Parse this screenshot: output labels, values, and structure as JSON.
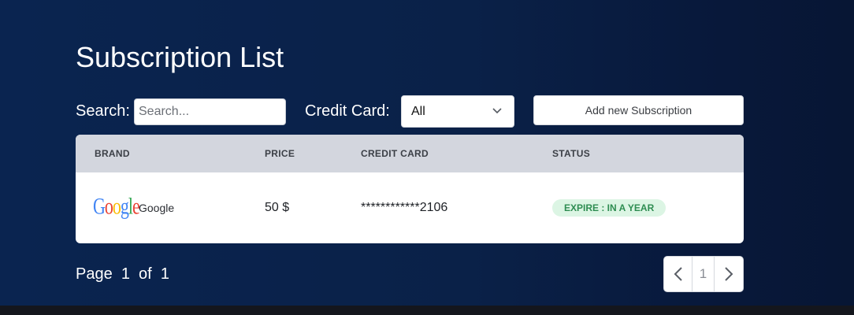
{
  "page": {
    "title": "Subscription List"
  },
  "filters": {
    "search_label": "Search:",
    "search_placeholder": "Search...",
    "credit_card_label": "Credit Card:",
    "credit_card_selected": "All",
    "add_button_label": "Add new Subscription"
  },
  "table": {
    "headers": [
      "BRAND",
      "PRICE",
      "CREDIT CARD",
      "STATUS"
    ],
    "rows": [
      {
        "brand_logo": [
          "G",
          "o",
          "o",
          "g",
          "l",
          "e"
        ],
        "brand": "Google",
        "price": "50 $",
        "credit_card": "************2106",
        "status": "EXPIRE : IN A YEAR"
      }
    ]
  },
  "pagination": {
    "page_text": "Page  1  of  1",
    "current_page": "1"
  },
  "colors": {
    "background": "#0a2450",
    "table_header": "#d3d6de",
    "status_badge_bg": "#dcf5e4",
    "status_badge_text": "#2f8d52"
  },
  "icons": {
    "select_chevron": "chevron-down-icon",
    "prev_page": "chevron-left-icon",
    "next_page": "chevron-right-icon"
  }
}
